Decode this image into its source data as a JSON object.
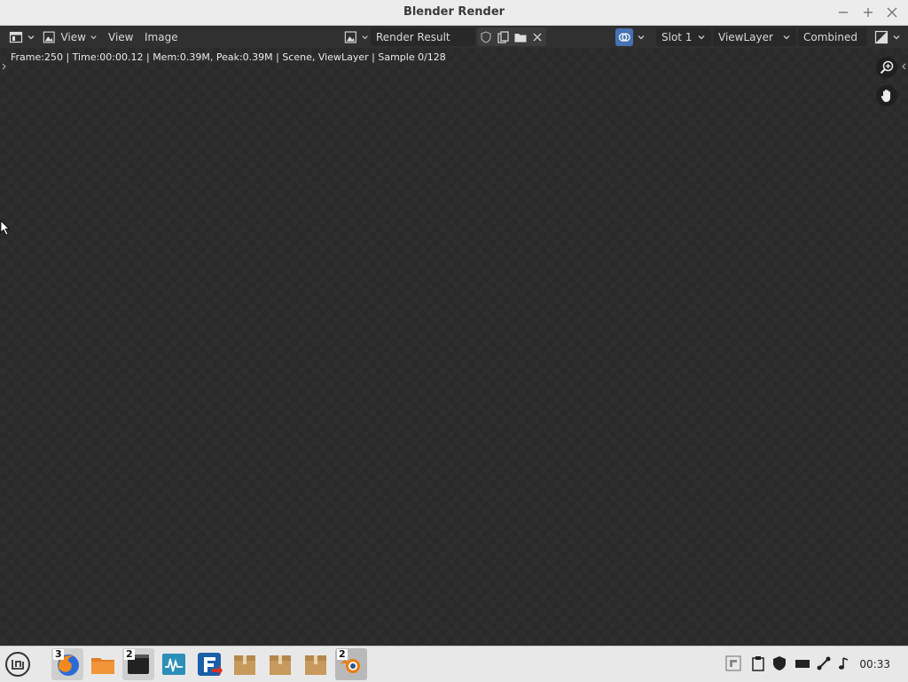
{
  "window": {
    "title": "Blender Render"
  },
  "header": {
    "view_menu_1": "View",
    "view_menu_2": "View",
    "image_menu": "Image",
    "image_name": "Render Result",
    "slot": "Slot 1",
    "view_layer": "ViewLayer",
    "pass": "Combined"
  },
  "canvas": {
    "stats": "Frame:250 | Time:00:00.12 | Mem:0.39M, Peak:0.39M | Scene, ViewLayer | Sample 0/128"
  },
  "taskbar": {
    "badges": {
      "firefox": "3",
      "terminal": "2",
      "blender": "2"
    },
    "clock": "00:33"
  },
  "colors": {
    "titlebar_bg": "#ececec",
    "header_bg": "#303030",
    "canvas_bg": "#2a2a2a",
    "accent": "#4772b3",
    "blender_orange": "#e87d0d"
  },
  "icons": [
    "editor-type-icon",
    "image-icon",
    "shield-icon",
    "duplicate-icon",
    "open-folder-icon",
    "close-icon",
    "overlay-icon",
    "display-channels-icon",
    "zoom-icon",
    "hand-icon",
    "menu-icon",
    "firefox-icon",
    "folder-icon",
    "terminal-icon",
    "monitor-icon",
    "filezilla-icon",
    "package-icon",
    "blender-icon",
    "clipboard-icon",
    "shield-tray-icon",
    "battery-icon",
    "network-icon",
    "volume-icon"
  ]
}
